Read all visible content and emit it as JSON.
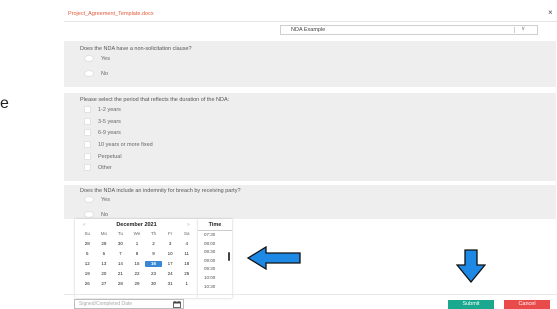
{
  "header": {
    "title": "Project_Agreement_Template.docx",
    "close_label": "×"
  },
  "template_select": {
    "value": "NDA Example",
    "chevron": "∨"
  },
  "questions": [
    {
      "text": "Does the NDA have a non-solicitation clause?",
      "options": [
        "Yes",
        "No"
      ]
    },
    {
      "text": "Please select the period that reflects the duration of the NDA:",
      "options": [
        "1-2 years",
        "3-5 years",
        "6-9 years",
        "10 years or more fixed",
        "Perpetual",
        "Other"
      ]
    },
    {
      "text": "Does the NDA include an indemnity for breach by receiving party?",
      "options": [
        "Yes",
        "No"
      ]
    }
  ],
  "calendar": {
    "prev": "<",
    "next": ">",
    "month_label": "December 2021",
    "weekdays": [
      "Su",
      "Mo",
      "Tu",
      "We",
      "Th",
      "Fr",
      "Sa"
    ],
    "weeks": [
      [
        "28",
        "29",
        "30",
        "1",
        "2",
        "3",
        "4"
      ],
      [
        "5",
        "6",
        "7",
        "8",
        "9",
        "10",
        "11"
      ],
      [
        "12",
        "13",
        "14",
        "15",
        "16",
        "17",
        "18"
      ],
      [
        "19",
        "20",
        "21",
        "22",
        "23",
        "24",
        "25"
      ],
      [
        "26",
        "27",
        "28",
        "29",
        "30",
        "31",
        "1"
      ]
    ],
    "selected_day": "16"
  },
  "time_picker": {
    "header": "Time",
    "times": [
      "07:30",
      "08:00",
      "08:30",
      "09:00",
      "09:30",
      "10:00",
      "10:30"
    ]
  },
  "edge_letter": "e",
  "footer": {
    "date_placeholder": "Signed/Completed Date",
    "submit_label": "Submit",
    "cancel_label": "Cancel"
  },
  "colors": {
    "accent_orange": "#e05a3a",
    "selected_blue": "#3a86d6",
    "arrow_blue": "#1e88e5",
    "submit_teal": "#1aa98f",
    "cancel_red": "#e94a4a"
  }
}
